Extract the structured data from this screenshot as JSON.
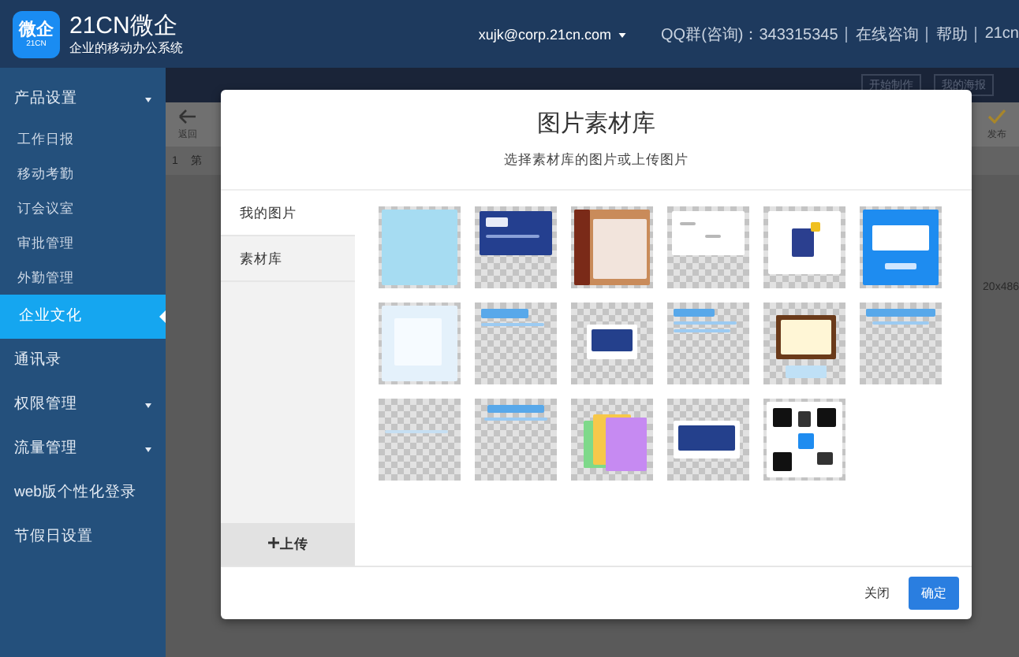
{
  "header": {
    "logo_mark": "微企",
    "logo_sub": "21CN",
    "brand": "21CN微企",
    "tagline": "企业的移动办公系统",
    "account": "xujk@corp.21cn.com",
    "links": [
      "QQ群(咨询)：343315345",
      "在线咨询",
      "帮助",
      "21cn"
    ]
  },
  "sidebar": {
    "items": [
      {
        "label": "产品设置",
        "kind": "group",
        "selected": false,
        "children": [
          {
            "label": "工作日报",
            "selected": false
          },
          {
            "label": "移动考勤",
            "selected": false
          },
          {
            "label": "订会议室",
            "selected": false
          },
          {
            "label": "审批管理",
            "selected": false
          },
          {
            "label": "外勤管理",
            "selected": false
          }
        ]
      },
      {
        "label": "企业文化",
        "kind": "link",
        "selected": true
      },
      {
        "label": "通讯录",
        "kind": "link",
        "selected": false
      },
      {
        "label": "权限管理",
        "kind": "group",
        "selected": false
      },
      {
        "label": "流量管理",
        "kind": "group",
        "selected": false
      },
      {
        "label": "web版个性化登录",
        "kind": "link",
        "selected": false
      },
      {
        "label": "节假日设置",
        "kind": "link",
        "selected": false
      }
    ]
  },
  "background": {
    "tabs": [
      "开始制作",
      "我的海报"
    ],
    "back": "返回",
    "publish": "发布",
    "row_number": "1",
    "row_text": "第",
    "size": "20x486"
  },
  "dialog": {
    "title": "图片素材库",
    "subtitle": "选择素材库的图片或上传图片",
    "sources": [
      {
        "label": "我的图片",
        "selected": true
      },
      {
        "label": "素材库",
        "selected": false
      }
    ],
    "upload": "上传",
    "buttons": [
      {
        "label": "关闭",
        "kind": "secondary"
      },
      {
        "label": "确定",
        "kind": "primary"
      }
    ]
  }
}
